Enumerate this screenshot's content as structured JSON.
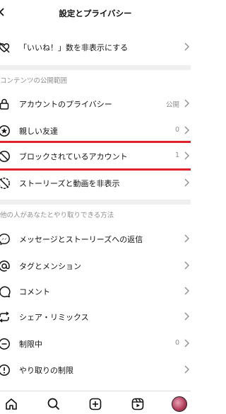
{
  "header": {
    "title": "設定とプライバシー"
  },
  "rows_top": [
    {
      "label": "「いいね！」数を非表示にする",
      "icon": "heart-off-icon"
    }
  ],
  "sections": {
    "content_visibility": "コンテンツの公開範囲",
    "interactions": "他の人があなたとやり取りできる方法"
  },
  "visibility_rows": [
    {
      "label": "アカウントのプライバシー",
      "value": "公開",
      "icon": "lock-icon"
    },
    {
      "label": "親しい友達",
      "value": "0",
      "icon": "star-icon"
    },
    {
      "label": "ブロックされているアカウント",
      "value": "1",
      "icon": "block-icon"
    },
    {
      "label": "ストーリーズと動画を非表示",
      "value": "",
      "icon": "hide-icon"
    }
  ],
  "interaction_rows": [
    {
      "label": "メッセージとストーリーズへの返信",
      "value": "",
      "icon": "messenger-icon"
    },
    {
      "label": "タグとメンション",
      "value": "",
      "icon": "at-icon"
    },
    {
      "label": "コメント",
      "value": "",
      "icon": "comment-icon"
    },
    {
      "label": "シェア・リミックス",
      "value": "",
      "icon": "repost-icon"
    },
    {
      "label": "制限中",
      "value": "0",
      "icon": "restrict-icon"
    },
    {
      "label": "やり取りの制限",
      "value": "",
      "icon": "limit-icon"
    }
  ],
  "tabbar": {
    "items": [
      "home-icon",
      "search-icon",
      "create-icon",
      "reels-icon",
      "profile-avatar"
    ]
  },
  "colors": {
    "highlight": "#e0232b",
    "secondary_text": "#8e8e8e",
    "divider": "#efefef"
  }
}
